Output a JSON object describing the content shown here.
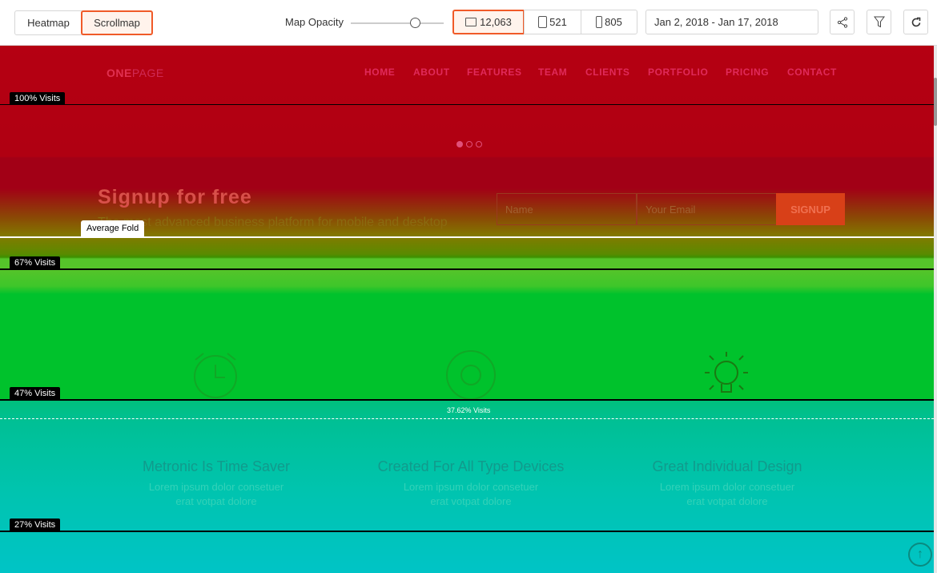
{
  "toolbar": {
    "heatmap": "Heatmap",
    "scrollmap": "Scrollmap",
    "opacity_label": "Map Opacity",
    "opacity_value": 0.78,
    "devices": [
      {
        "icon": "desktop-icon",
        "count": "12,063"
      },
      {
        "icon": "tablet-icon",
        "count": "521"
      },
      {
        "icon": "mobile-icon",
        "count": "805"
      }
    ],
    "date_range": "Jan 2, 2018 - Jan 17, 2018"
  },
  "site": {
    "logo_a": "ONE",
    "logo_b": "PAGE",
    "nav": [
      "HOME",
      "ABOUT",
      "FEATURES",
      "TEAM",
      "CLIENTS",
      "PORTFOLIO",
      "PRICING",
      "CONTACT"
    ],
    "signup_title": "Signup for free",
    "signup_sub": "The most advanced business platform for mobile and desktop",
    "name_ph": "Name",
    "email_ph": "Your Email",
    "signup_btn": "SIGNUP",
    "features": [
      {
        "title": "Metronic Is Time Saver",
        "l1": "Lorem ipsum dolor consetuer",
        "l2": "erat votpat dolore"
      },
      {
        "title": "Created For All Type Devices",
        "l1": "Lorem ipsum dolor consetuer",
        "l2": "erat votpat dolore"
      },
      {
        "title": "Great Individual Design",
        "l1": "Lorem ipsum dolor consetuer",
        "l2": "erat votpat dolore"
      }
    ]
  },
  "markers": {
    "v100": "100% Visits",
    "fold": "Average Fold",
    "v67": "67% Visits",
    "v47": "47% Visits",
    "v37": "37.62% Visits",
    "v27": "27% Visits"
  }
}
